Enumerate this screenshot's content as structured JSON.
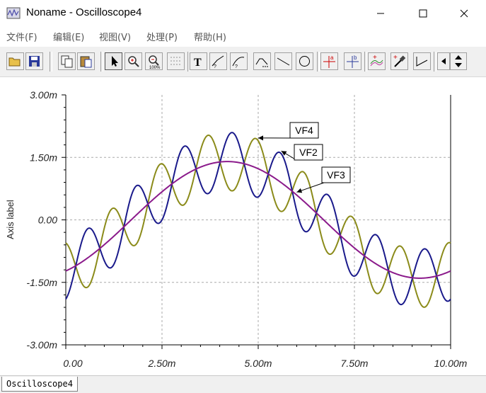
{
  "window": {
    "title": "Noname - Oscilloscope4",
    "minimize_icon": "minimize-icon",
    "maximize_icon": "maximize-icon",
    "close_icon": "close-icon"
  },
  "menu": {
    "items": [
      "文件(F)",
      "编辑(E)",
      "视图(V)",
      "处理(P)",
      "帮助(H)"
    ]
  },
  "toolbar": {
    "buttons": [
      "open-icon",
      "save-icon",
      "copy-icon",
      "paste-icon",
      "pointer-icon",
      "zoom-in-icon",
      "zoom-100-icon",
      "grid-icon",
      "text-icon",
      "draw-line-icon",
      "draw-curve-icon",
      "draw-step-icon",
      "line-icon",
      "circle-icon",
      "cursor-a-icon",
      "cursor-b-icon",
      "add-curve-icon",
      "probe-icon",
      "slope-icon",
      "scroll-left-icon",
      "scroll-up-down-icon"
    ]
  },
  "tab": {
    "label": "Oscilloscope4"
  },
  "colors": {
    "vf4": "#8b8b1a",
    "vf2": "#1a1a8b",
    "vf3": "#8b1a8b",
    "grid": "#aaaaaa",
    "background": "#ffffff"
  },
  "chart_data": {
    "type": "line",
    "ylabel": "Axis label",
    "xlabel": "",
    "xlim": [
      0,
      10
    ],
    "ylim": [
      -3,
      3
    ],
    "x_ticks": [
      "0.00",
      "2.50m",
      "5.00m",
      "7.50m",
      "10.00m"
    ],
    "y_ticks": [
      "3.00m",
      "1.50m",
      "0.00",
      "-1.50m",
      "-3.00m"
    ],
    "grid": true,
    "series": [
      {
        "name": "VF4",
        "color": "#8b8b1a",
        "components": [
          {
            "amp": 1.4,
            "period_ms": 10,
            "phase_ms": 1.7
          },
          {
            "amp": 0.7,
            "period_ms": 1.25,
            "phase_ms": 0.88
          }
        ]
      },
      {
        "name": "VF2",
        "color": "#1a1a8b",
        "components": [
          {
            "amp": 1.4,
            "period_ms": 10,
            "phase_ms": 1.7
          },
          {
            "amp": 0.7,
            "period_ms": 1.25,
            "phase_ms": 0.26
          }
        ]
      },
      {
        "name": "VF3",
        "color": "#8b1a8b",
        "components": [
          {
            "amp": 1.4,
            "period_ms": 10,
            "phase_ms": 1.7
          }
        ]
      }
    ],
    "annotations": [
      {
        "text": "VF4",
        "points_to_x": 5.0,
        "series": "VF4"
      },
      {
        "text": "VF2",
        "points_to_x": 5.6,
        "series": "VF2"
      },
      {
        "text": "VF3",
        "points_to_x": 6.0,
        "series": "VF3"
      }
    ]
  }
}
